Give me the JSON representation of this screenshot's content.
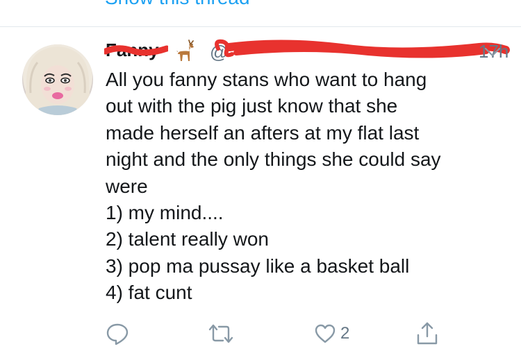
{
  "thread_link": {
    "label": "Show this thread"
  },
  "tweet": {
    "display_name": "Fanny",
    "handle": "@",
    "time": "17h",
    "text_lines": [
      "All you fanny stans who want to hang",
      "out with the pig just know that she",
      "made herself an afters at my flat last",
      "night and the only things she could say",
      "were",
      "1) my mind....",
      "2) talent really won",
      "3) pop ma pussay like a basket ball",
      "4) fat cunt"
    ],
    "like_count": "2"
  },
  "icons": {
    "name_emoji": "deer-icon",
    "menu": "chevron-down-icon",
    "reply": "reply-icon",
    "retweet": "retweet-icon",
    "like": "heart-icon",
    "share": "share-icon"
  },
  "colors": {
    "accent": "#1da1f2",
    "secondary_text": "#657786",
    "redaction": "#e8322e",
    "divider": "#e1e8ed",
    "text": "#14171a"
  }
}
